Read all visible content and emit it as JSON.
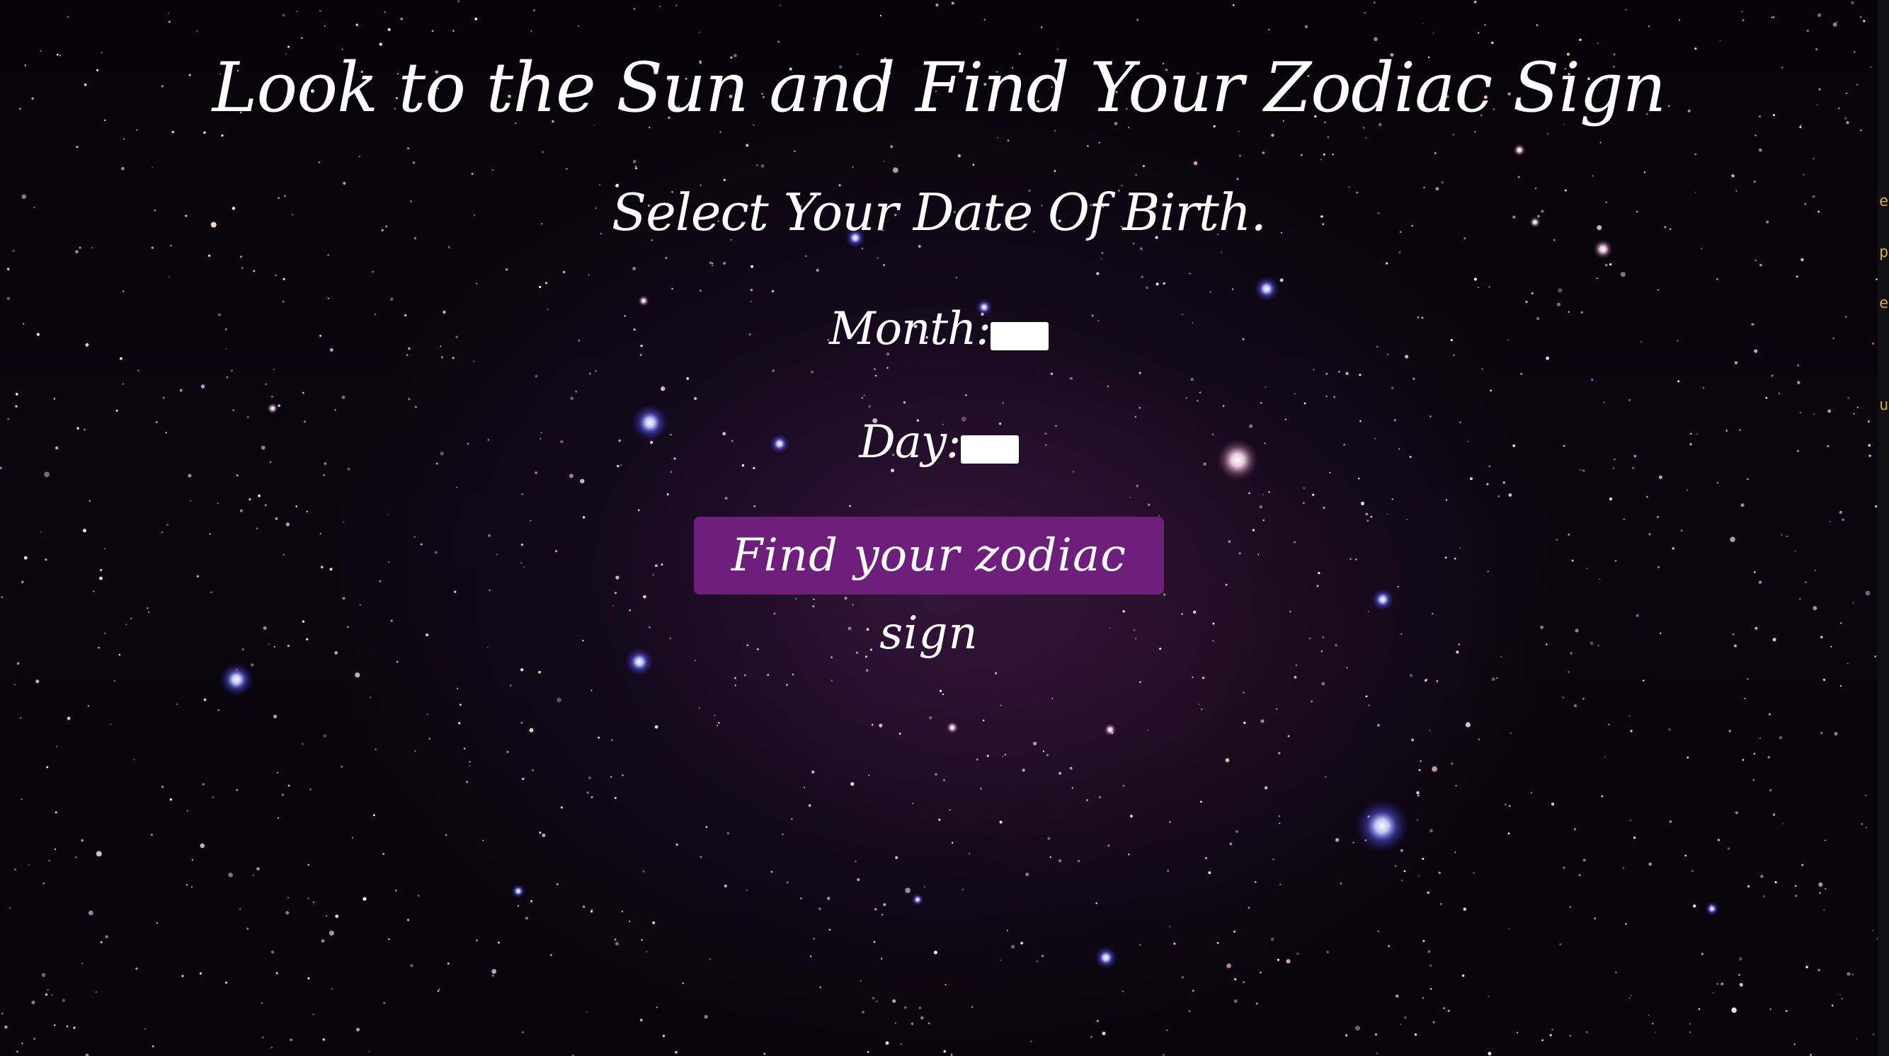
{
  "page": {
    "title": "Look to the Sun and Find Your Zodiac Sign",
    "subtitle": "Select Your Date Of Birth."
  },
  "form": {
    "month_label": "Month:",
    "month_value": "",
    "day_label": "Day:",
    "day_value": "",
    "submit_label": "Find your zodiac sign"
  },
  "side_strip": {
    "letters": [
      "e",
      "p",
      "e",
      "u"
    ]
  },
  "colors": {
    "background": "#060409",
    "button": "#6e1f7c",
    "text": "#ffffff",
    "side_strip_text": "#c9a64a"
  }
}
